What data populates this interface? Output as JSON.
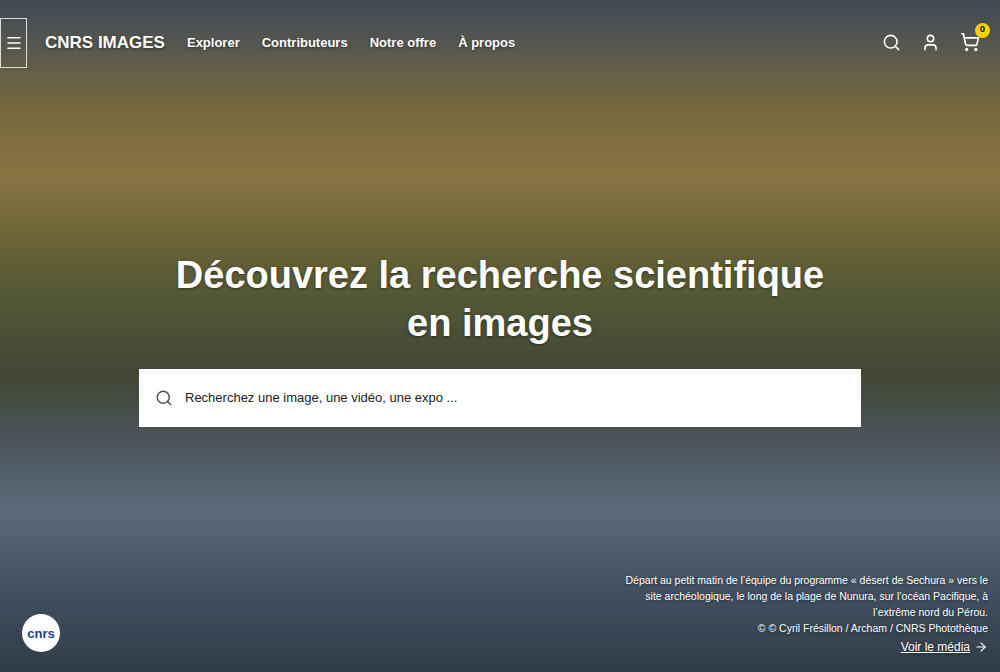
{
  "header": {
    "brand": "CNRS IMAGES",
    "nav": [
      "Explorer",
      "Contributeurs",
      "Notre offre",
      "À propos"
    ],
    "cart_count": "0"
  },
  "hero": {
    "heading_lines": [
      "Découvrez la recherche scientifique",
      "en images"
    ],
    "search": {
      "placeholder": "Recherchez une image, une vidéo, une expo ..."
    }
  },
  "media": {
    "caption": "Départ au petit matin de l’équipe du programme « désert de Sechura » vers le site archéologique, le long de la plage de Nunura, sur l’océan Pacifique, à l’extrême nord du Pérou.",
    "credit": "© © Cyril Frésillon / Archam / CNRS Photothèque",
    "link": "Voir le média"
  },
  "logo": {
    "text": "cnrs"
  }
}
